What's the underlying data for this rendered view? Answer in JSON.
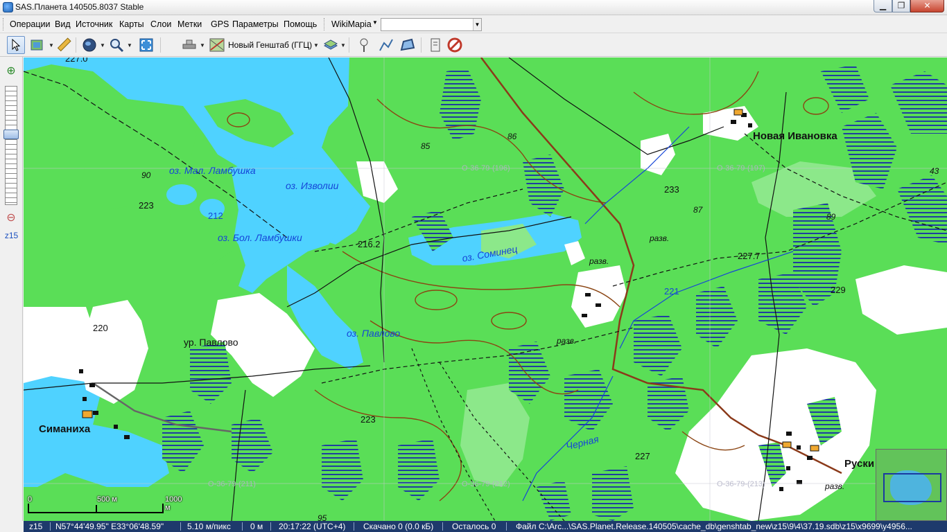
{
  "window": {
    "title": "SAS.Планета 140505.8037 Stable",
    "minimize_glyph": "▁",
    "maximize_glyph": "❐",
    "close_glyph": "✕"
  },
  "menu": {
    "items": [
      "Операции",
      "Вид",
      "Источник",
      "Карты",
      "Слои",
      "Метки",
      "GPS",
      "Параметры",
      "Помощь"
    ],
    "wikimapia": "WikiMapia",
    "search_value": ""
  },
  "toolbar": {
    "map_name": "Новый Генштаб (ГГЦ)",
    "icons": [
      "cursor-icon",
      "layers-icon",
      "ruler-icon",
      "globe-icon",
      "search-icon",
      "fullscreen-icon",
      "satellite-icon",
      "map-source-icon",
      "layer-stack-icon",
      "placemark-icon",
      "path-icon",
      "polygon-icon",
      "notes-icon",
      "disable-icon"
    ]
  },
  "zoom": {
    "level_label": "z15",
    "level_fraction": 0.6
  },
  "map": {
    "lakes": [
      "оз. Мал. Ламбушка",
      "оз. Изволии",
      "оз. Бол. Ламбушки",
      "оз. Соминец",
      "оз. Павлово"
    ],
    "places": [
      "Новая Ивановка",
      "Симаниха",
      "ур. Павлово",
      "Руски"
    ],
    "river": "Черная",
    "notes": [
      "разв.",
      "разв.",
      "разв.",
      "разв."
    ],
    "heights": [
      "90",
      "223",
      "85",
      "86",
      "216.2",
      "233",
      "87",
      "89",
      "227.7",
      "229",
      "220",
      "223",
      "227",
      "95",
      "43"
    ],
    "water_heights": [
      "212",
      "221"
    ],
    "sheet_labels": [
      "O-36-79-(196)",
      "O-36-79-(197)",
      "O-36-79-(211)",
      "O-36-79-(212)",
      "O-36-79-(213)",
      "227.0"
    ],
    "scale": {
      "zero": "0",
      "mid": "500 м",
      "end": "1000 м"
    }
  },
  "status": {
    "zoom": "z15",
    "coords": "N57°44'49.95\" E33°06'48.59\"",
    "resolution": "5.10 м/пикс",
    "altitude": "0 м",
    "time": "20:17:22 (UTC+4)",
    "downloaded": "Скачано 0 (0.0 кБ)",
    "remaining": "Осталось 0",
    "file": "Файл C:\\Arc...\\SAS.Planet.Release.140505\\cache_db\\genshtab_new\\z15\\9\\4\\37.19.sdb\\z15\\x9699\\y4956..."
  },
  "colors": {
    "forest": "#5ade57",
    "water": "#4fd2ff",
    "clearing": "#ffffff",
    "light_green": "#8ce88a",
    "road": "#8b3a1a",
    "status_bg": "#1e3a6c"
  }
}
